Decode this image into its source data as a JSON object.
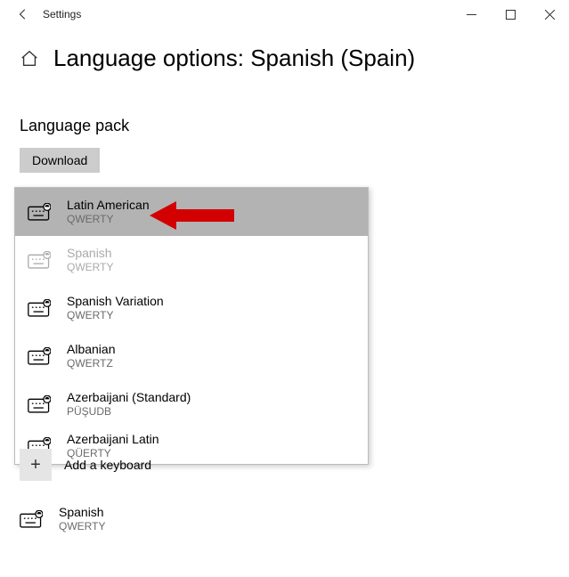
{
  "window": {
    "title": "Settings"
  },
  "page": {
    "title": "Language options: Spanish (Spain)"
  },
  "section": {
    "title": "Language pack",
    "download": "Download"
  },
  "dropdown": {
    "items": [
      {
        "name": "Latin American",
        "sub": "QWERTY"
      },
      {
        "name": "Spanish",
        "sub": "QWERTY"
      },
      {
        "name": "Spanish Variation",
        "sub": "QWERTY"
      },
      {
        "name": "Albanian",
        "sub": "QWERTZ"
      },
      {
        "name": "Azerbaijani (Standard)",
        "sub": "PÜŞUDB"
      },
      {
        "name": "Azerbaijani Latin",
        "sub": "QÜERTY"
      }
    ]
  },
  "add": {
    "label": "Add a keyboard"
  },
  "existing": {
    "name": "Spanish",
    "sub": "QWERTY"
  }
}
